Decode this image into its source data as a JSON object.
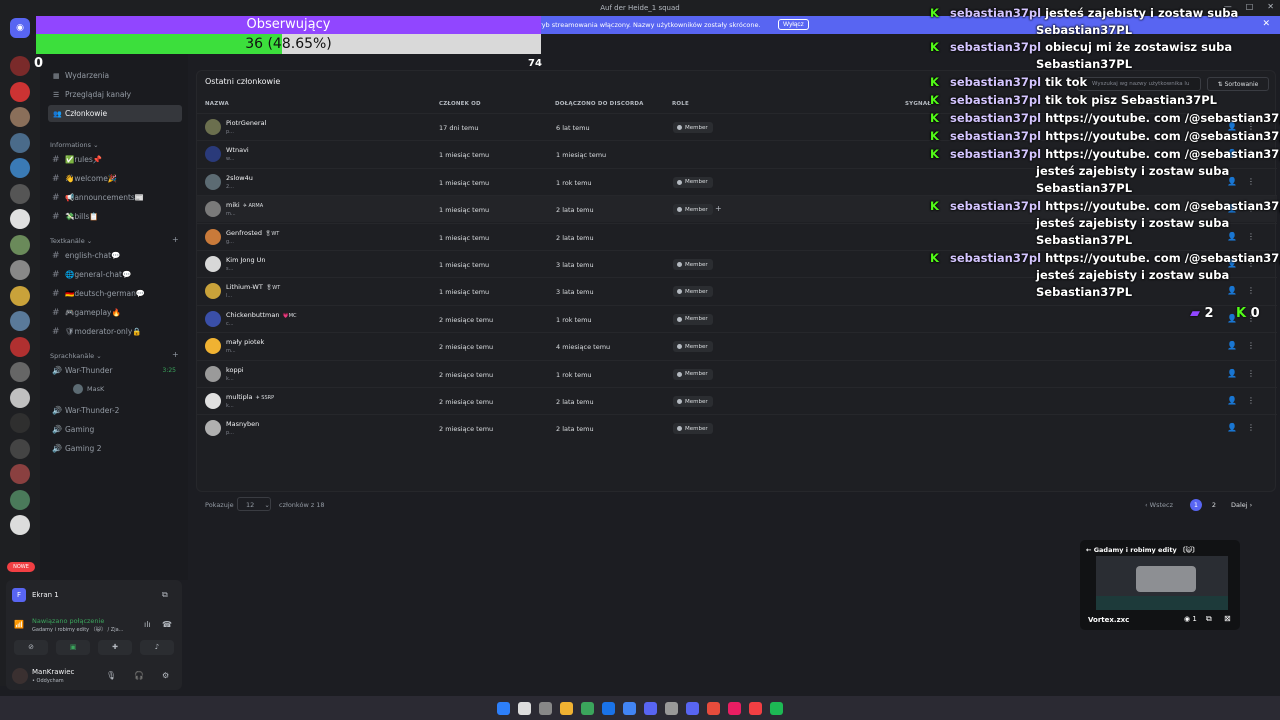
{
  "window": {
    "title": "Auf der Heide_1 squad"
  },
  "banner": {
    "text": "Tryb streamowania włączony. Nazwy użytkowników zostały skrócone.",
    "button": "Wyłącz"
  },
  "follow_overlay": {
    "title": "Obserwujący",
    "progress_text": "36 (48.65%)",
    "progress_fraction": 0.4865,
    "min": "0",
    "max": "74"
  },
  "channel_nav": {
    "events": "Wydarzenia",
    "browse": "Przeglądaj kanały",
    "members": "Członkowie"
  },
  "categories": {
    "info": "Informations",
    "text": "Textkanäle",
    "voice": "Sprachkanäle"
  },
  "info_channels": [
    "✅rules📌",
    "👋welcome🎉",
    "📢announcements📰",
    "💸bills📋"
  ],
  "text_channels": [
    "english-chat💬",
    "🌐general-chat💬",
    "🇩🇪deutsch-german💬",
    "🎮gameplay🔥",
    "🛡moderator-only🔒"
  ],
  "voice_channels": [
    {
      "name": "War-Thunder",
      "timer": "3:25",
      "user": "MasK"
    },
    {
      "name": "War-Thunder-2"
    },
    {
      "name": "Gaming"
    },
    {
      "name": "Gaming 2"
    }
  ],
  "live_label": "NOWE",
  "screen_share": {
    "title": "Ekran 1"
  },
  "voice_status": {
    "state": "Nawiązano połączenie",
    "channel": "Gadamy i robimy edity 〔😺〕 / Zja..."
  },
  "user": {
    "name": "ManKrawiec",
    "status": "• Oddycham"
  },
  "members_panel": {
    "title": "Ostatni członkowie",
    "search_placeholder": "Wyszukaj wg nazwy użytkownika lu",
    "sort_label": "Sortowanie",
    "columns": {
      "name": "NAZWA",
      "member_since": "CZŁONEK OD",
      "joined": "DOŁĄCZONO DO DISCORDA",
      "roles": "ROLE",
      "signals": "SYGNAŁ"
    },
    "rows": [
      {
        "name": "PiotrGeneral",
        "tag": "",
        "sub": "p...",
        "member_since": "17 dni temu",
        "joined": "6 lat temu",
        "role": "Member",
        "color": "#6b6f4e"
      },
      {
        "name": "Wtnavi",
        "tag": "",
        "sub": "w...",
        "member_since": "1 miesiąc temu",
        "joined": "1 miesiąc temu",
        "role": "",
        "color": "#2a3a7a"
      },
      {
        "name": "2slow4u",
        "tag": "",
        "sub": "2...",
        "member_since": "1 miesiąc temu",
        "joined": "1 rok temu",
        "role": "Member",
        "color": "#5c6b73"
      },
      {
        "name": "miki",
        "tag": "✈ ARMA",
        "sub": "m...",
        "member_since": "1 miesiąc temu",
        "joined": "2 lata temu",
        "role": "Member",
        "color": "#7a7a7a"
      },
      {
        "name": "Genfrosted",
        "tag": "🎖WT",
        "sub": "g...",
        "member_since": "1 miesiąc temu",
        "joined": "2 lata temu",
        "role": "",
        "color": "#c97a3a"
      },
      {
        "name": "Kim Jong Un",
        "tag": "",
        "sub": "s...",
        "member_since": "1 miesiąc temu",
        "joined": "3 lata temu",
        "role": "Member",
        "color": "#d8d8d8"
      },
      {
        "name": "Lithium-WT",
        "tag": "🎖WT",
        "sub": "l...",
        "member_since": "1 miesiąc temu",
        "joined": "3 lata temu",
        "role": "Member",
        "color": "#c9a23a"
      },
      {
        "name": "Chickenbuttman",
        "tag": "💗MC",
        "sub": "c...",
        "member_since": "2 miesiące temu",
        "joined": "1 rok temu",
        "role": "Member",
        "color": "#3a4fa8"
      },
      {
        "name": "mały piotek",
        "tag": "",
        "sub": "m...",
        "member_since": "2 miesiące temu",
        "joined": "4 miesiące temu",
        "role": "Member",
        "color": "#f0b232"
      },
      {
        "name": "koppi",
        "tag": "",
        "sub": "k...",
        "member_since": "2 miesiące temu",
        "joined": "1 rok temu",
        "role": "Member",
        "color": "#9a9a9a"
      },
      {
        "name": "multipla",
        "tag": "✈ SSRP",
        "sub": "k...",
        "member_since": "2 miesiące temu",
        "joined": "2 lata temu",
        "role": "Member",
        "color": "#e0e0e0"
      },
      {
        "name": "Masnyben",
        "tag": "",
        "sub": "p...",
        "member_since": "2 miesiące temu",
        "joined": "2 lata temu",
        "role": "Member",
        "color": "#b0b0b0"
      }
    ],
    "footer": {
      "showing": "Pokazuje",
      "per_page": "12",
      "of_total": "członków z 18",
      "prev": "Wstecz",
      "page1": "1",
      "page2": "2",
      "next": "Dalej"
    }
  },
  "chat_overlay": [
    {
      "user": "sebastian37pl",
      "msg": "jesteś zajebisty i zostaw suba",
      "msg2": "Sebastian37PL"
    },
    {
      "user": "sebastian37pl",
      "msg": "obiecuj mi że zostawisz suba",
      "msg2": "Sebastian37PL"
    },
    {
      "user": "sebastian37pl",
      "msg": "tik tok",
      "msg2": ""
    },
    {
      "user": "sebastian37pl",
      "msg": "tik tok pisz Sebastian37PL",
      "msg2": ""
    },
    {
      "user": "sebastian37pl",
      "msg": "https://youtube. com /@sebastian37pl",
      "msg2": ""
    },
    {
      "user": "sebastian37pl",
      "msg": "https://youtube. com /@sebastian37pl",
      "msg2": ""
    },
    {
      "user": "sebastian37pl",
      "msg": "https://youtube. com /@sebastian37pl",
      "msg2": "jesteś zajebisty i zostaw suba|Sebastian37PL"
    },
    {
      "user": "sebastian37pl",
      "msg": "https://youtube. com /@sebastian37pl",
      "msg2": "jesteś zajebisty i zostaw suba|Sebastian37PL"
    },
    {
      "user": "sebastian37pl",
      "msg": "https://youtube. com /@sebastian37pl",
      "msg2": "jesteś zajebisty i zostaw suba|Sebastian37PL"
    }
  ],
  "viewer_counts": {
    "twitch": "2",
    "kick": "0"
  },
  "stream_preview": {
    "title": "← Gadamy i robimy edity 〔😺〕",
    "user": "Vortex.zxc",
    "viewers": "1"
  }
}
